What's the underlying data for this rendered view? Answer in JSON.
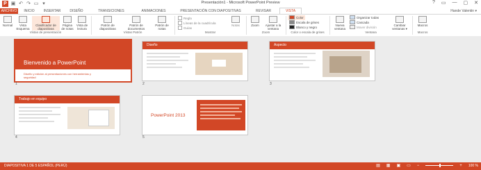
{
  "window": {
    "title": "Presentación1 - Microsoft PowerPoint Preview",
    "logo": "P",
    "user": "Hande Valentin ▾",
    "controls": [
      "?",
      "▭",
      "—",
      "▢",
      "✕"
    ]
  },
  "qat": [
    "save-icon",
    "undo-icon",
    "redo-icon",
    "slideshow-icon",
    "customize-icon"
  ],
  "tabs": [
    "ARCHIVO",
    "INICIO",
    "INSERTAR",
    "DISEÑO",
    "TRANSICIONES",
    "ANIMACIONES",
    "PRESENTACIÓN CON DIAPOSITIVAS",
    "REVISAR",
    "VISTA"
  ],
  "active_tab": "VISTA",
  "ribbon": {
    "buttons": [
      {
        "label": "Normal",
        "selected": false
      },
      {
        "label": "Vista Esquema",
        "selected": false
      },
      {
        "label": "Clasificador de diapositivas",
        "selected": true
      },
      {
        "label": "Página de notas",
        "selected": false
      },
      {
        "label": "Vista de lectura",
        "selected": false
      },
      {
        "label": "Patrón de diapositivas",
        "selected": false
      },
      {
        "label": "Patrón de documentos",
        "selected": false
      },
      {
        "label": "Patrón de notas",
        "selected": false
      }
    ],
    "show": [
      {
        "label": "Regla"
      },
      {
        "label": "Líneas de la cuadrícula"
      },
      {
        "label": "Guías"
      }
    ],
    "notes_label": "Notas",
    "zoom_buttons": [
      "Zoom",
      "Ajustar a la ventana"
    ],
    "color_options": [
      {
        "label": "Color",
        "swatch": "#d24726"
      },
      {
        "label": "Escala de grises",
        "swatch": "#888888"
      },
      {
        "label": "Blanco y negro",
        "swatch": "#222222"
      }
    ],
    "window_buttons": [
      "Nueva ventana"
    ],
    "window_small": [
      "Organizar todas",
      "Cascada",
      "Mover división"
    ],
    "switch_label": "Cambiar ventanas ▾",
    "macros_label": "Macros",
    "groups": [
      "Vistas de presentación",
      "Vistas Patrón",
      "Mostrar",
      "Zoom",
      "Color o escala de grises",
      "Ventana",
      "Macros"
    ]
  },
  "slides": [
    {
      "num": "1",
      "kind": "title",
      "title": "Bienvenido a PowerPoint",
      "subtitle": "Diseño y edición al presentaciones con herramientas y seguridad"
    },
    {
      "num": "2",
      "kind": "content",
      "title": "Diseño"
    },
    {
      "num": "3",
      "kind": "content",
      "title": "Aspecto"
    },
    {
      "num": "4",
      "kind": "content",
      "title": "Trabajo en equipo"
    },
    {
      "num": "5",
      "kind": "final",
      "title": "PowerPoint 2013"
    }
  ],
  "status": {
    "left": "DIAPOSITIVA 1 DE 5    ESPAÑOL (PERÚ)",
    "zoom": "100 %",
    "accent": "#d24726"
  }
}
